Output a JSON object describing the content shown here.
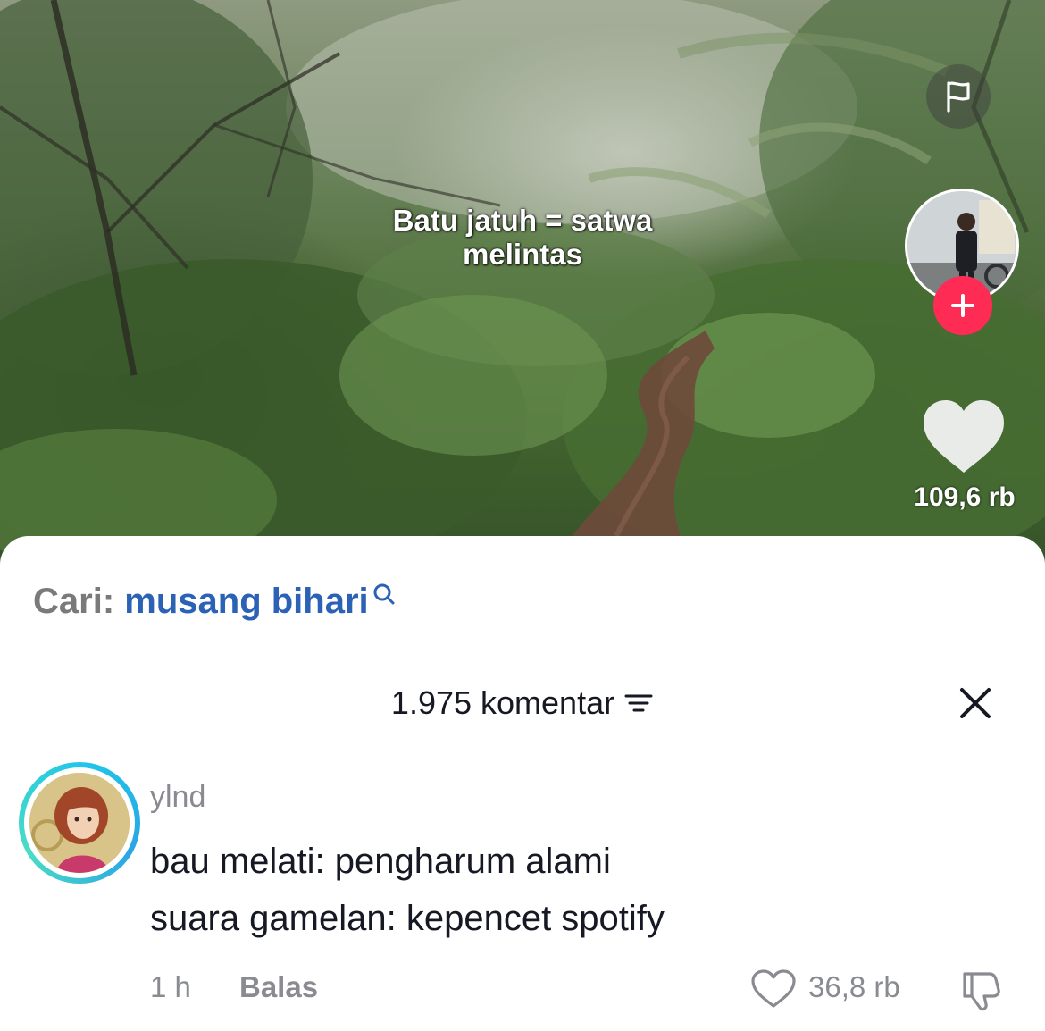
{
  "video": {
    "caption_line1": "Batu jatuh = satwa",
    "caption_line2": "melintas",
    "like_count": "109,6 rb",
    "follow_symbol": "+"
  },
  "search": {
    "prefix": "Cari:",
    "term": "musang bihari"
  },
  "comments_header": {
    "count_label": "1.975 komentar"
  },
  "comment": {
    "username": "ylnd",
    "line1": "bau melati: pengharum alami",
    "line2": "suara gamelan: kepencet spotify",
    "time": "1 h",
    "reply_label": "Balas",
    "like_count": "36,8 rb"
  },
  "icons": {
    "flag": "flag-icon",
    "follow": "plus-icon",
    "heart": "heart-icon",
    "search": "search-icon",
    "sort": "sort-icon",
    "close": "close-icon",
    "dislike": "thumbs-down-icon"
  },
  "colors": {
    "follow_red": "#fe2c55",
    "search_link_blue": "#2b62b5",
    "avatar_ring": "#21c7e8",
    "secondary_text": "#8a8b91"
  }
}
